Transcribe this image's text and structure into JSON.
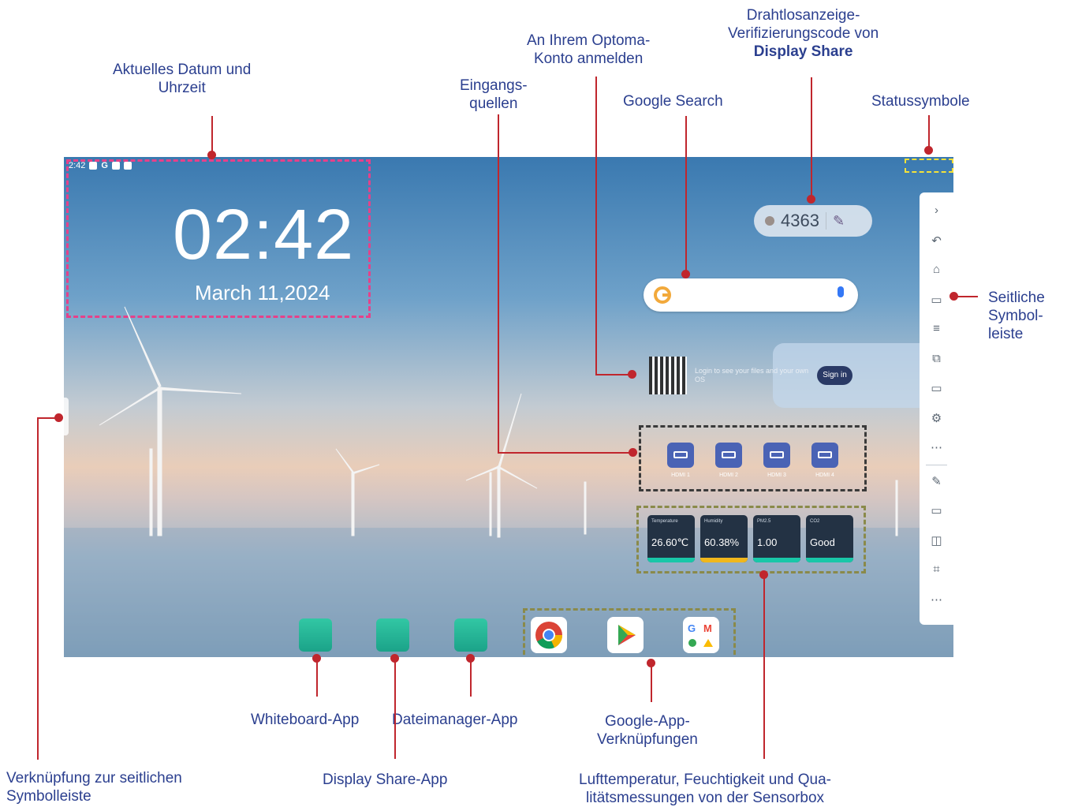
{
  "callouts": {
    "datetime": "Aktuelles Datum und\nUhrzeit",
    "inputs": "Eingangs-\nquellen",
    "login": "An Ihrem Optoma-\nKonto anmelden",
    "google_search": "Google Search",
    "code_line1": "Drahtlosanzeige-",
    "code_line2": "Verifizierungscode von",
    "code_line3": "Display Share",
    "status": "Statussymbole",
    "sidebar": "Seitliche\nSymbol-\nleiste",
    "sidebar_shortcut": "Verknüpfung zur seitlichen\nSymbolleiste",
    "whiteboard": "Whiteboard-App",
    "displayshare": "Display Share-App",
    "filemanager": "Dateimanager-App",
    "google_apps": "Google-App-\nVerknüpfungen",
    "sensors": "Lufttemperatur, Feuchtigkeit und Qua-\nlitätsmessungen von der Sensorbox"
  },
  "screen": {
    "status_time": "2:42",
    "status_g": "G",
    "clock": "02:42",
    "date": "March 11,2024",
    "share_code": "4363",
    "login_text": "Login to see your files and your own OS",
    "sign_in": "Sign in",
    "sources": [
      "HDMI 1",
      "HDMI 2",
      "HDMI 3",
      "HDMI 4"
    ],
    "sensors": [
      {
        "label": "Temperature",
        "value": "26.60℃",
        "color": "#19c7a8"
      },
      {
        "label": "Humidity",
        "value": "60.38%",
        "color": "#f0b71c"
      },
      {
        "label": "PM2.5",
        "value": "1.00",
        "color": "#19c7a8"
      },
      {
        "label": "CO2",
        "value": "Good",
        "color": "#19c7a8"
      }
    ],
    "rail_icons": [
      "chevron-right-icon",
      "back-icon",
      "home-icon",
      "window-icon",
      "menu-icon",
      "cast-icon",
      "screen-icon",
      "settings-icon",
      "apps-icon",
      "pen-icon",
      "ratio-icon",
      "record-icon",
      "crop-icon",
      "more-icon"
    ]
  }
}
